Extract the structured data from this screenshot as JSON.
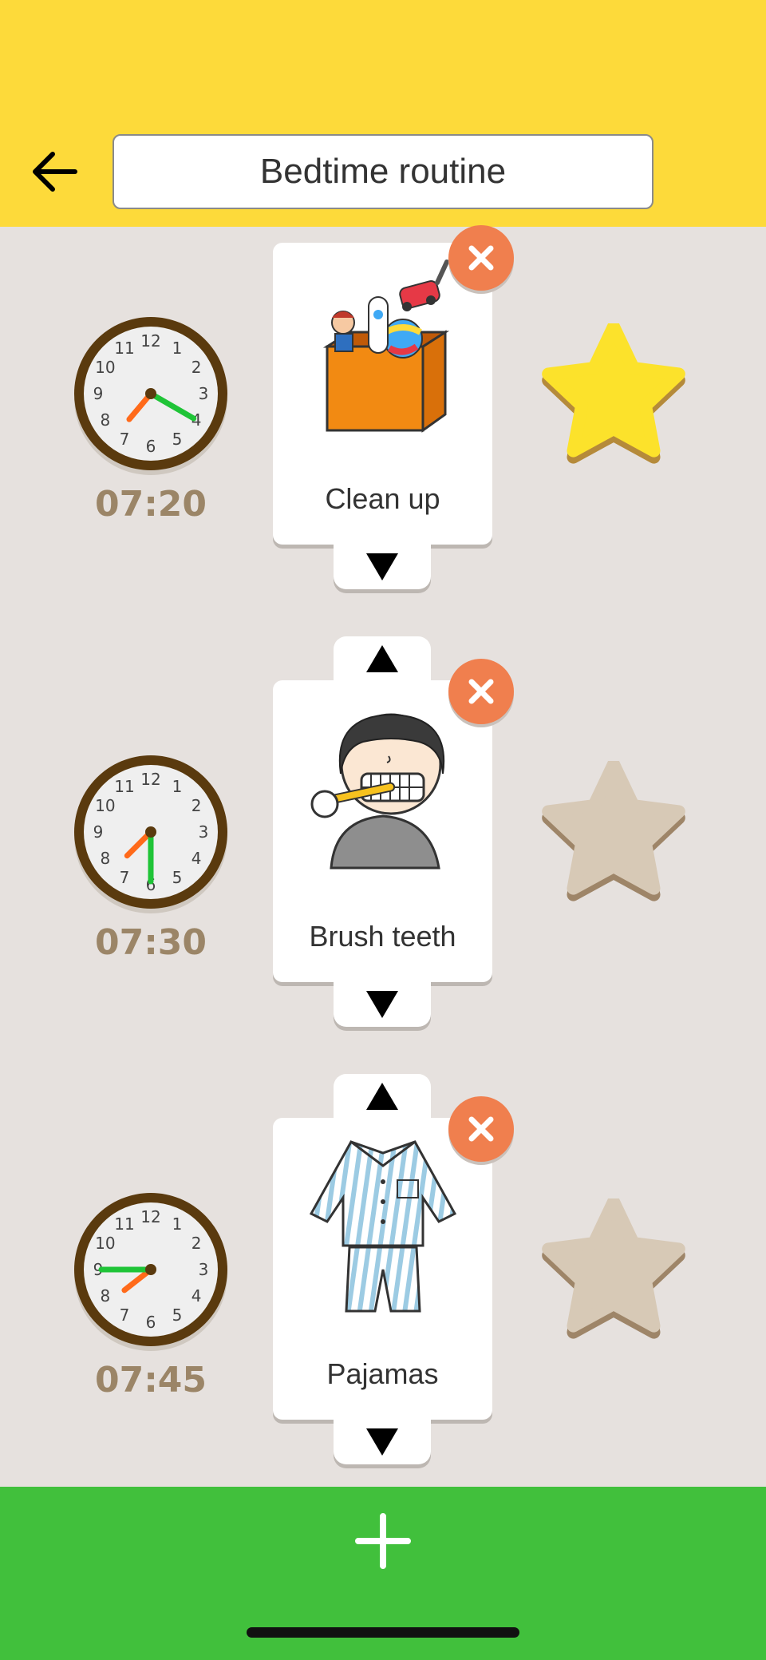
{
  "header": {
    "title": "Bedtime routine",
    "back_icon": "arrow-left-icon",
    "background": "#FDDA3A"
  },
  "routine": [
    {
      "time": "07:20",
      "hour_hand_deg": 220,
      "minute_hand_deg": 120,
      "label": "Clean up",
      "image": "toy-box-illustration",
      "star_earned": true
    },
    {
      "time": "07:30",
      "hour_hand_deg": 225,
      "minute_hand_deg": 180,
      "label": "Brush teeth",
      "image": "child-brushing-teeth-illustration",
      "star_earned": false
    },
    {
      "time": "07:45",
      "hour_hand_deg": 232,
      "minute_hand_deg": 270,
      "label": "Pajamas",
      "image": "striped-pajamas-illustration",
      "star_earned": false
    }
  ],
  "controls": {
    "remove_icon": "close-icon",
    "move_up_icon": "triangle-up-icon",
    "move_down_icon": "triangle-down-icon"
  },
  "footer": {
    "add_icon": "plus-icon",
    "background": "#41C03C"
  },
  "colors": {
    "remove": "#F07F4E",
    "star_active": "#FCE22B",
    "star_inactive": "#D7C9B6",
    "time_text": "#9B8567",
    "hour_hand": "#FF6A1A",
    "minute_hand": "#1FC437"
  }
}
